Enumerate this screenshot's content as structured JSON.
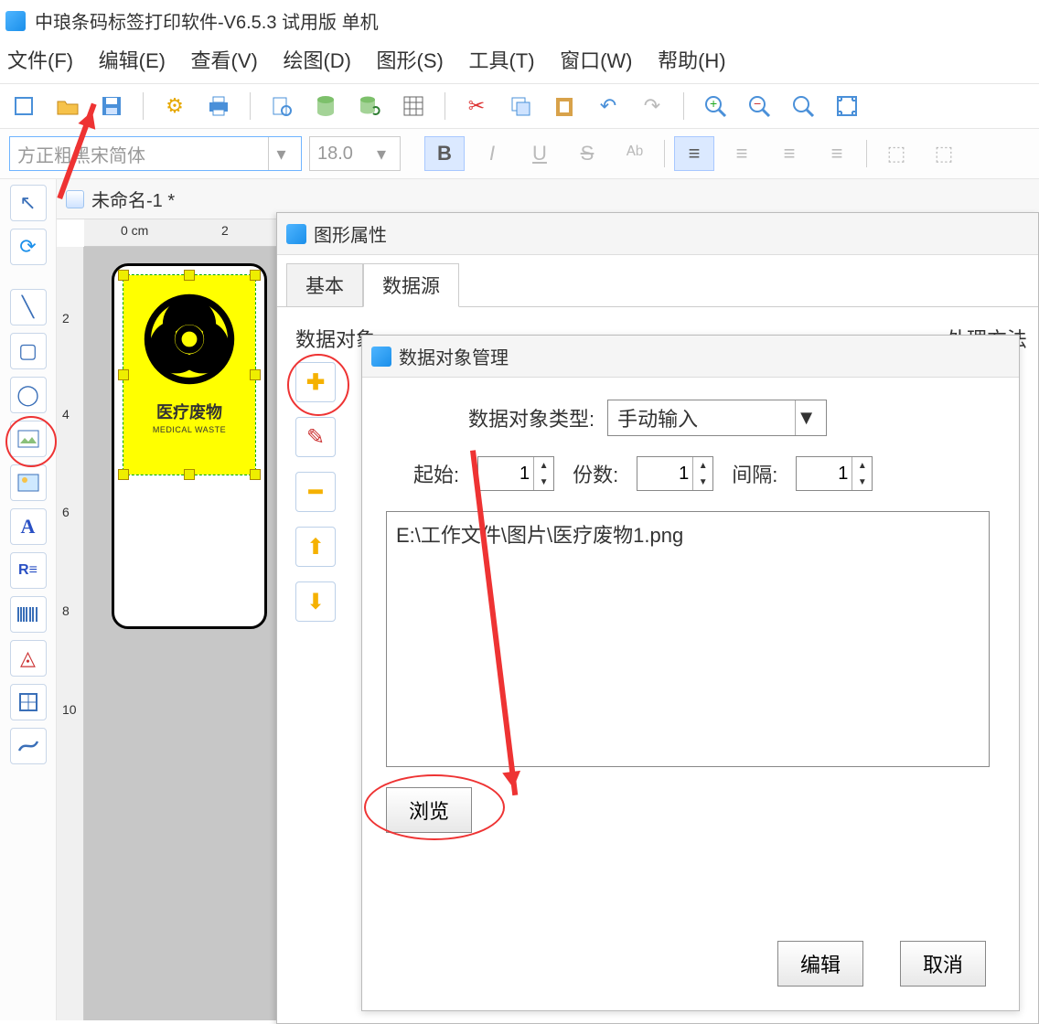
{
  "app": {
    "title": "中琅条码标签打印软件-V6.5.3 试用版 单机"
  },
  "menu": {
    "file": "文件(F)",
    "edit": "编辑(E)",
    "view": "查看(V)",
    "draw": "绘图(D)",
    "shape": "图形(S)",
    "tool": "工具(T)",
    "window": "窗口(W)",
    "help": "帮助(H)"
  },
  "format": {
    "font": "方正粗黑宋简体",
    "size": "18.0"
  },
  "doc": {
    "tab": "未命名-1 *"
  },
  "ruler": {
    "h0": "0 cm",
    "h2": "2",
    "v2": "2",
    "v4": "4",
    "v6": "6",
    "v8": "8",
    "v10": "10"
  },
  "label_image": {
    "line1": "医疗废物",
    "line2": "MEDICAL WASTE"
  },
  "props": {
    "title": "图形属性",
    "tab_basic": "基本",
    "tab_data": "数据源",
    "section_obj": "数据对象",
    "section_method": "处理方法"
  },
  "dlg2": {
    "title": "数据对象管理",
    "type_label": "数据对象类型:",
    "type_value": "手动输入",
    "start_label": "起始:",
    "start_value": "1",
    "count_label": "份数:",
    "count_value": "1",
    "interval_label": "间隔:",
    "interval_value": "1",
    "path": "E:\\工作文件\\图片\\医疗废物1.png",
    "browse": "浏览",
    "edit": "编辑",
    "cancel": "取消"
  }
}
